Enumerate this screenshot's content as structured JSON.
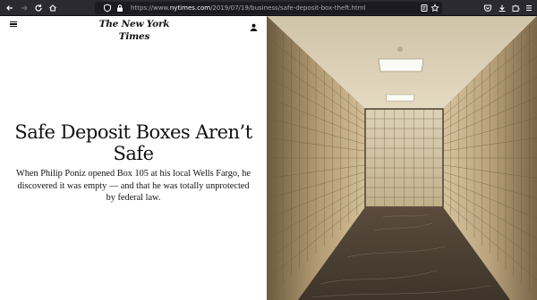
{
  "browser": {
    "url_prefix": "https://www.",
    "url_host": "nytimes.com",
    "url_path": "/2019/07/19/business/safe-deposit-box-theft.html",
    "icons": {
      "back": "back-arrow-icon",
      "forward": "forward-arrow-icon",
      "reload": "reload-icon",
      "home": "home-icon",
      "tracking": "shield-icon",
      "lock": "lock-icon",
      "reader": "reader-view-icon",
      "bookmark": "star-icon",
      "pocket": "pocket-icon",
      "downloads": "download-icon",
      "extensions": "puzzle-icon",
      "menu": "app-menu-icon"
    },
    "colors": {
      "toolbar": "#2b2a33",
      "urlbar": "#1c1b22"
    }
  },
  "site": {
    "masthead": "The New York Times"
  },
  "article": {
    "headline": "Safe Deposit Boxes Aren’t Safe",
    "summary": "When Philip Poniz opened Box 105 at his local Wells Fargo, he discovered it was empty — and that he was totally unprotected by federal law.",
    "image": "photo of a bank vault corridor lined with safe deposit boxes"
  }
}
